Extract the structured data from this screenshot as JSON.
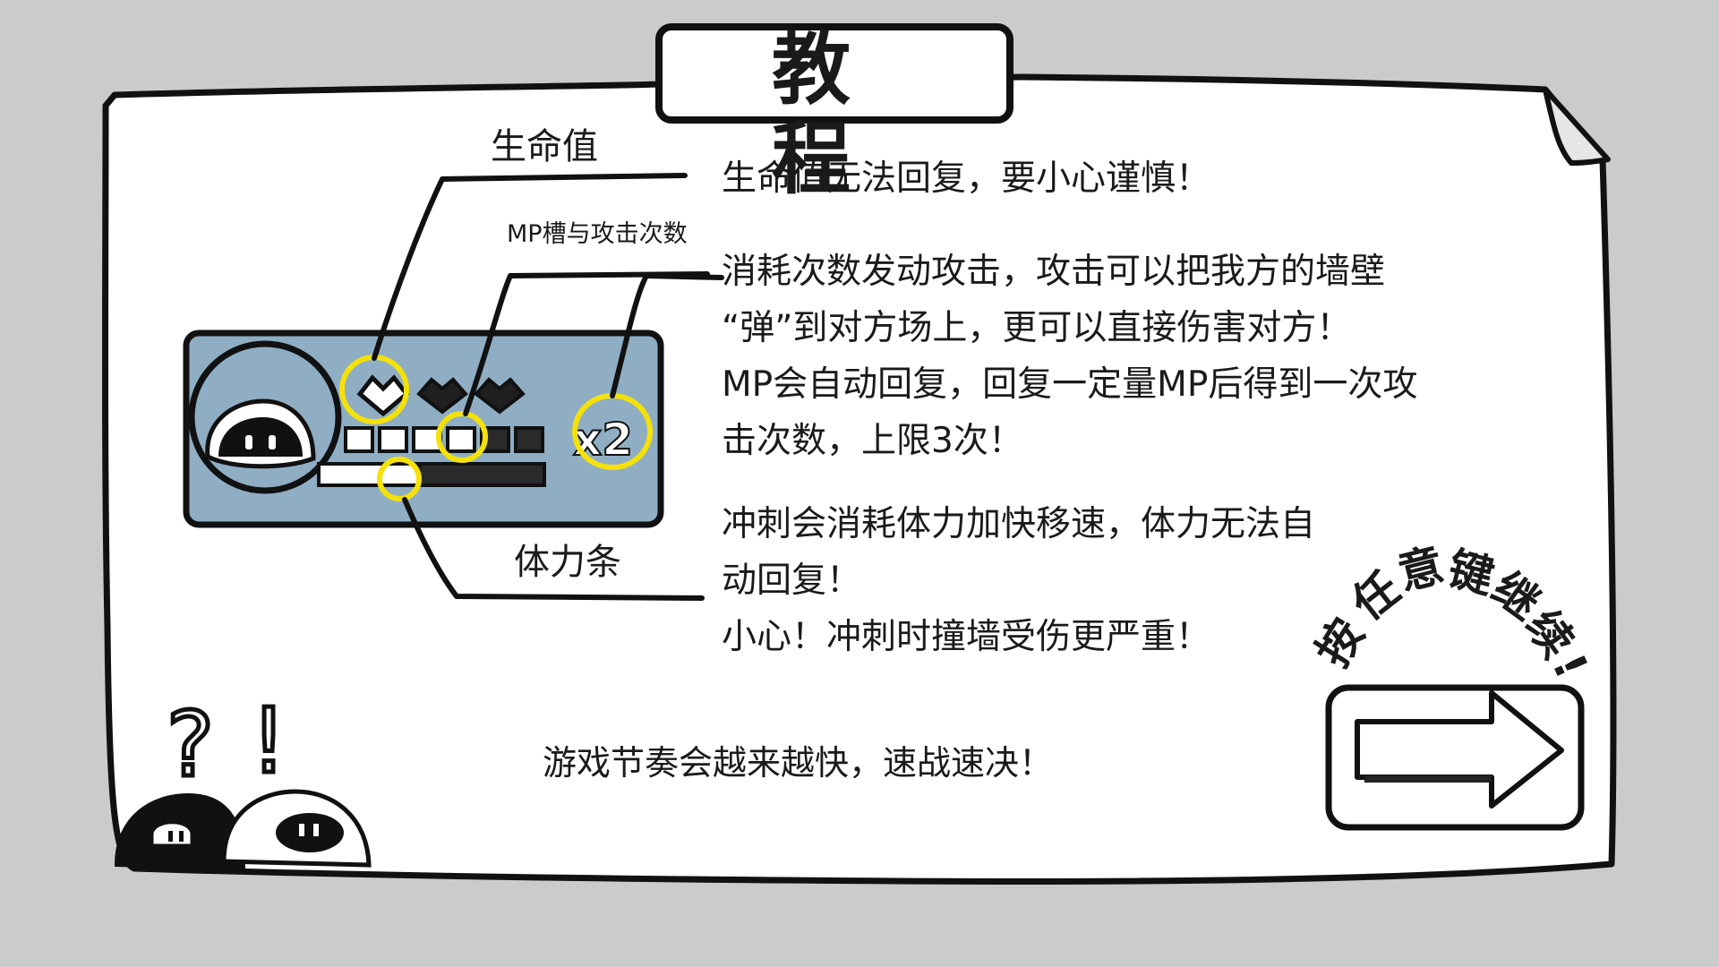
{
  "title": "教 程",
  "labels": {
    "hp": "生命值",
    "mp": "MP槽与攻击次数",
    "stamina": "体力条"
  },
  "hud": {
    "attack_count": "x2"
  },
  "descriptions": {
    "hp": [
      "生命值无法回复，要小心谨慎！"
    ],
    "mp": [
      "消耗次数发动攻击，攻击可以把我方的墙壁",
      "“弹”到对方场上，更可以直接伤害对方！",
      "MP会自动回复，回复一定量MP后得到一次攻",
      "击次数，上限3次！"
    ],
    "stamina": [
      "冲刺会消耗体力加快移速，体力无法自",
      "动回复！",
      "小心！冲刺时撞墙受伤更严重！"
    ]
  },
  "bottom_hint": "游戏节奏会越来越快，速战速决！",
  "continue_hint": [
    "按",
    "任",
    "意",
    "键",
    "继",
    "续",
    "!"
  ],
  "decorations": {
    "question_mark": "?",
    "exclamation_mark": "!"
  },
  "colors": {
    "background": "#cbcbcb",
    "panel": "#ffffff",
    "hud": "#8faec4",
    "highlight": "#f5e10a",
    "ink": "#111111"
  }
}
